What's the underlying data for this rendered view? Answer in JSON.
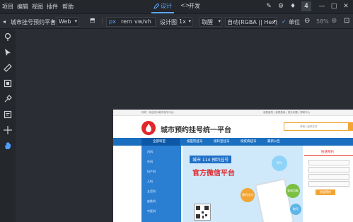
{
  "menu": [
    "项目",
    "编辑",
    "视图",
    "插件",
    "帮助"
  ],
  "modes": {
    "design": "设计",
    "develop": "开发",
    "develop_icon": "<>"
  },
  "window": {
    "badge": "4"
  },
  "toolbar": {
    "page_title": "城市挂号预约平台",
    "device": "Web",
    "units": [
      "px",
      "rem",
      "vw/vh"
    ],
    "design_label": "设计图",
    "scale": "1x",
    "color_pick": "取醒",
    "color_format": "自动(RGBA || Hex)",
    "unit_check": "单位",
    "zoom": "58%"
  },
  "preview": {
    "top_left": "你好！欢迎访问城市挂号平台",
    "top_right": "我是医院 | 我是患者 | 常见问题 | 帮助中心",
    "logo": "城市预约挂号统一平台",
    "search_placeholder": "请输入医院名称",
    "nav": [
      "全部科室",
      "按医院挂号",
      "按科室挂号",
      "按疾病挂号",
      "最新公告"
    ],
    "left_items": [
      "内科",
      "外科",
      "妇产科",
      "儿科",
      "五官科",
      "皮肤科",
      "中医科"
    ],
    "banner_tag": "城市 114 预约挂号",
    "banner_title": "官方微信平台",
    "bubbles": [
      "预约挂号",
      "查询功能",
      "取号",
      "BTV"
    ],
    "right_title": "快速预约",
    "right_button": "快速预约"
  },
  "colors": {
    "accent": "#5fa8ff",
    "brand_red": "#e3262b",
    "nav_blue": "#1b6fc0",
    "orange": "#f2a533"
  }
}
